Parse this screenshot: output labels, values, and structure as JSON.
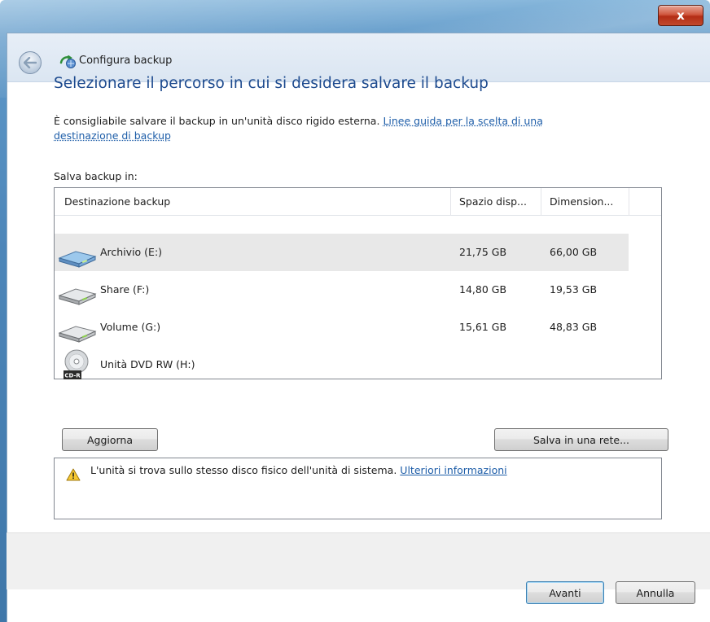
{
  "window": {
    "title": "Configura backup",
    "close_label": "x"
  },
  "main": {
    "heading": "Selezionare il percorso in cui si desidera salvare il backup",
    "description": "È consigliabile salvare il backup in un'unità disco rigido esterna.",
    "guide_link_line1": "Linee guida per la scelta di una",
    "guide_link_line2": "destinazione di backup",
    "save_label": "Salva backup in:"
  },
  "list": {
    "columns": [
      "Destinazione backup",
      "Spazio disp...",
      "Dimension..."
    ],
    "rows": [
      {
        "name": "Archivio (E:)",
        "free": "21,75 GB",
        "size": "66,00 GB",
        "icon": "hard-drive-icon",
        "selected": true
      },
      {
        "name": "Share (F:)",
        "free": "14,80 GB",
        "size": "19,53 GB",
        "icon": "hard-drive-icon",
        "selected": false
      },
      {
        "name": "Volume (G:)",
        "free": "15,61 GB",
        "size": "48,83 GB",
        "icon": "hard-drive-icon",
        "selected": false
      },
      {
        "name": "Unità DVD RW (H:)",
        "free": "",
        "size": "",
        "icon": "dvd-drive-icon",
        "selected": false
      }
    ]
  },
  "buttons": {
    "refresh": "Aggiorna",
    "save_network": "Salva in una rete...",
    "next": "Avanti",
    "cancel": "Annulla"
  },
  "info": {
    "message": "L'unità si trova sullo stesso disco fisico dell'unità di sistema.",
    "link": "Ulteriori informazioni"
  },
  "dvd_icon_label": "CD-R",
  "colors": {
    "heading": "#1e4b8f",
    "link": "#1d5da8",
    "selected_row": "#e8e8e8",
    "frame": "#4d86b9"
  }
}
